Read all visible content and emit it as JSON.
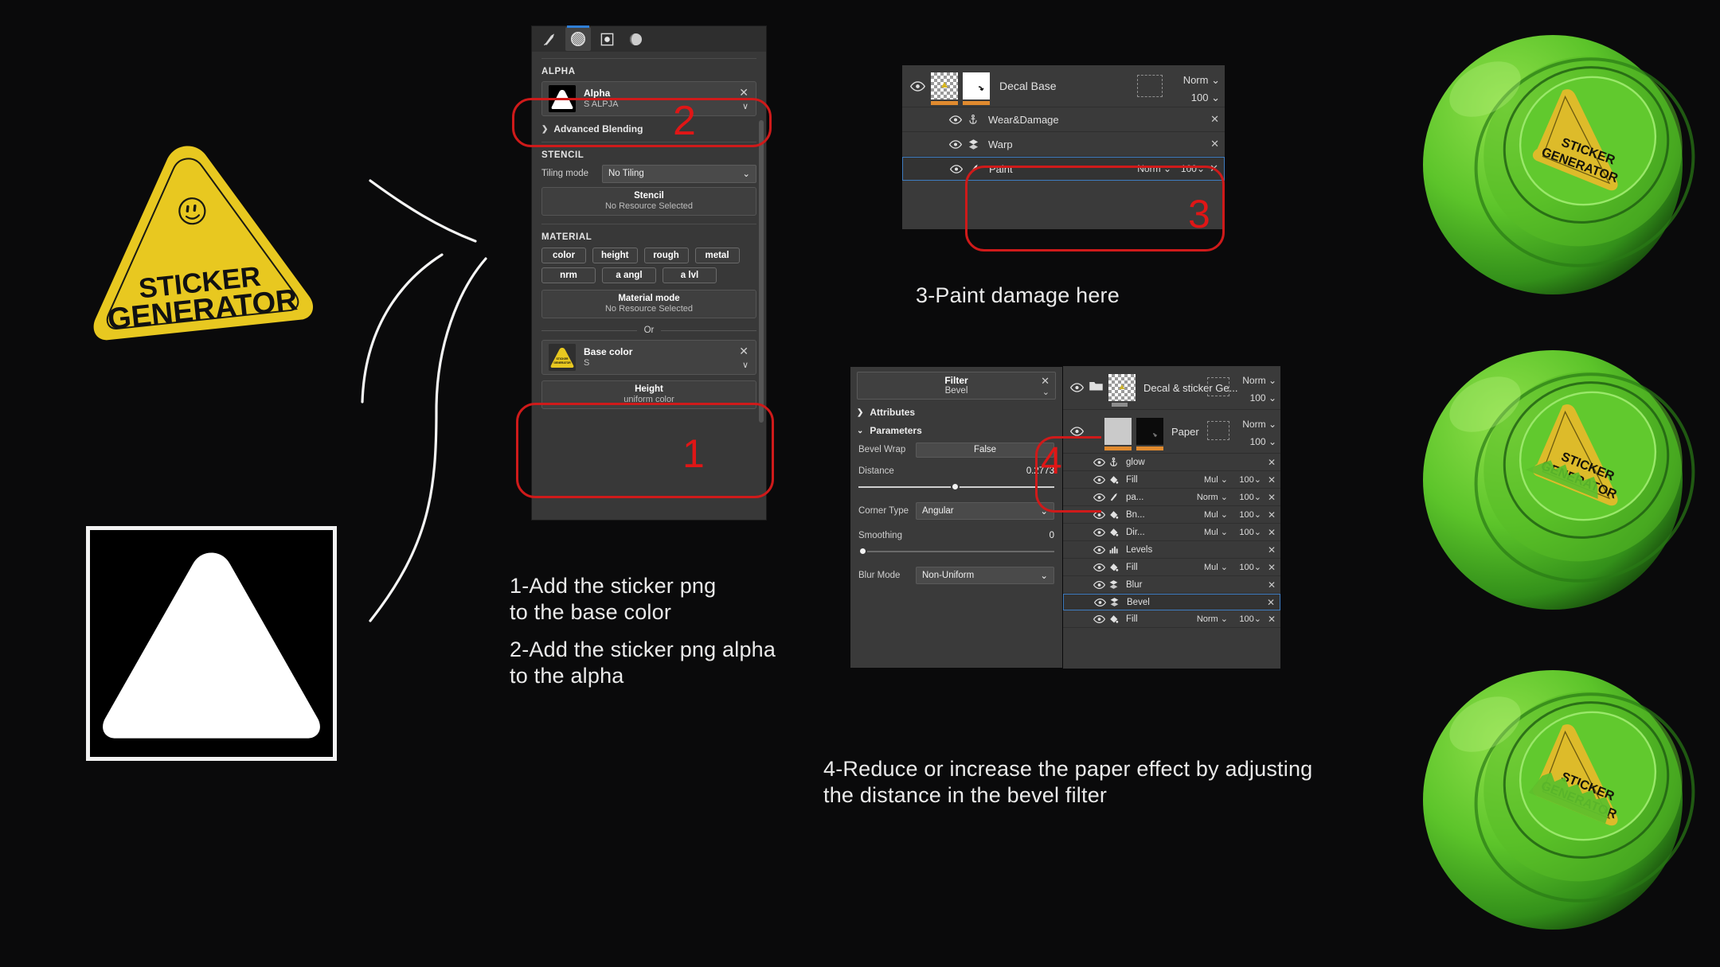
{
  "background_color": "#0a0a0b",
  "sticker": {
    "line1": "STICKER",
    "line2": "GENERATOR",
    "fill_color": "#e8c820",
    "text_color": "#111111"
  },
  "alpha_preview": {
    "label": "alpha-mask-image",
    "bg": "#000000",
    "shape": "#ffffff"
  },
  "material_panel": {
    "tabs": [
      {
        "icon": "brush-icon",
        "active": false
      },
      {
        "icon": "grid-sphere-icon",
        "active": true
      },
      {
        "icon": "square-dot-icon",
        "active": false
      },
      {
        "icon": "sphere-shade-icon",
        "active": false
      }
    ],
    "alpha_section": {
      "title": "ALPHA",
      "resource": {
        "name": "Alpha",
        "sub": "S ALPJA",
        "thumb": "triangle-mask-thumb"
      },
      "close_glyph": "✕",
      "chevron_glyph": "∨"
    },
    "advanced_blending": "Advanced Blending",
    "stencil_section": {
      "title": "STENCIL",
      "tiling_label": "Tiling mode",
      "tiling_value": "No Tiling",
      "stencil_btn_title": "Stencil",
      "stencil_btn_sub": "No Resource Selected"
    },
    "material_section": {
      "title": "MATERIAL",
      "chips": [
        "color",
        "height",
        "rough",
        "metal",
        "nrm",
        "a angl",
        "a lvl"
      ],
      "mode_title": "Material mode",
      "mode_sub": "No Resource Selected",
      "or_label": "Or",
      "base_color": {
        "name": "Base color",
        "sub": "S",
        "thumb": "sticker-triangle-thumb"
      },
      "height_title": "Height",
      "height_sub": "uniform color"
    }
  },
  "layer_panel": {
    "main": {
      "name": "Decal Base",
      "blend": "Norm",
      "opacity": "100",
      "eye": "eye-icon",
      "thumb_a": "checker-thumb",
      "thumb_b": "white-mask-thumb"
    },
    "sub_layers": [
      {
        "name": "Wear&Damage",
        "icon": "anchor-icon",
        "blend": "",
        "opacity": "",
        "close": "✕"
      },
      {
        "name": "Warp",
        "icon": "warp-icon",
        "blend": "",
        "opacity": "",
        "close": "✕"
      },
      {
        "name": "Paint",
        "icon": "brush-icon",
        "blend": "Norm",
        "opacity": "100",
        "close": "✕",
        "selected": true
      }
    ]
  },
  "filter_panel": {
    "header_title": "Filter",
    "header_sub": "Bevel",
    "attributes_label": "Attributes",
    "parameters_label": "Parameters",
    "params": {
      "bevel_wrap_label": "Bevel Wrap",
      "bevel_wrap_value": "False",
      "distance_label": "Distance",
      "distance_value": "0.2773",
      "distance_pct": 47,
      "corner_type_label": "Corner Type",
      "corner_type_value": "Angular",
      "smoothing_label": "Smoothing",
      "smoothing_value": "0",
      "smoothing_pct": 0,
      "blur_mode_label": "Blur Mode",
      "blur_mode_value": "Non-Uniform"
    }
  },
  "stack_panel": {
    "groups": [
      {
        "name": "Decal & sticker Ge...",
        "blend": "Norm",
        "opacity": "100",
        "icon": "folder-icon",
        "thumb": "checker-thumb"
      },
      {
        "name": "Paper",
        "blend": "Norm",
        "opacity": "100",
        "thumb_a": "grey-thumb",
        "thumb_b": "black-mask-thumb"
      }
    ],
    "effects": [
      {
        "name": "glow",
        "icon": "anchor-icon",
        "blend": "",
        "opacity": "",
        "close": "✕"
      },
      {
        "name": "Fill",
        "icon": "fill-icon",
        "blend": "Mul",
        "opacity": "100",
        "close": "✕"
      },
      {
        "name": "pa...",
        "icon": "brush-icon",
        "blend": "Norm",
        "opacity": "100",
        "close": "✕"
      },
      {
        "name": "Bn...",
        "icon": "fill-icon",
        "blend": "Mul",
        "opacity": "100",
        "close": "✕"
      },
      {
        "name": "Dir...",
        "icon": "fill-icon",
        "blend": "Mul",
        "opacity": "100",
        "close": "✕"
      },
      {
        "name": "Levels",
        "icon": "levels-icon",
        "blend": "",
        "opacity": "",
        "close": "✕"
      },
      {
        "name": "Fill",
        "icon": "fill-icon",
        "blend": "Mul",
        "opacity": "100",
        "close": "✕"
      },
      {
        "name": "Blur",
        "icon": "warp-icon",
        "blend": "",
        "opacity": "",
        "close": "✕"
      },
      {
        "name": "Bevel",
        "icon": "warp-icon",
        "blend": "",
        "opacity": "",
        "close": "✕",
        "selected": true
      },
      {
        "name": "Fill",
        "icon": "fill-icon",
        "blend": "Norm",
        "opacity": "100",
        "close": "✕"
      }
    ]
  },
  "callouts": {
    "num1": "1",
    "num2": "2",
    "num3": "3",
    "num4": "4",
    "color": "#e01616"
  },
  "notes": {
    "step1_l1": "1-Add the sticker png",
    "step1_l2": "to the base color",
    "step2_l1": "2-Add the sticker png alpha",
    "step2_l2": "to the alpha",
    "step3": "3-Paint damage here",
    "step4_l1": "4-Reduce or increase the paper effect by adjusting",
    "step4_l2": "the distance in the bevel filter"
  },
  "renders": [
    {
      "name": "green-sphere-render-top"
    },
    {
      "name": "green-sphere-render-middle"
    },
    {
      "name": "green-sphere-render-bottom"
    }
  ]
}
